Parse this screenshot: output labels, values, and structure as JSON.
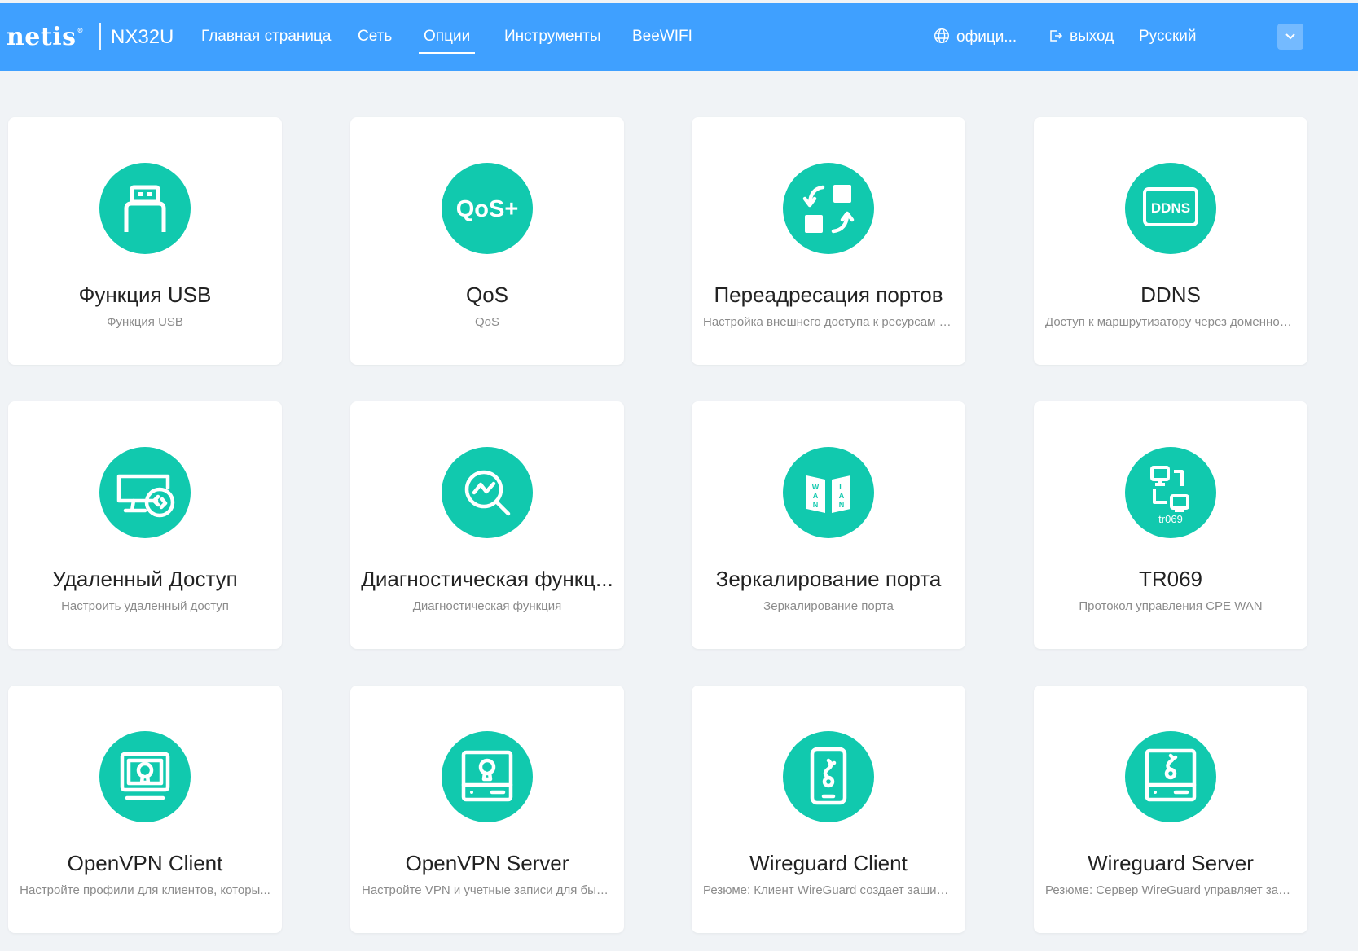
{
  "header": {
    "brand": "netis",
    "brand_mark": "®",
    "model": "NX32U",
    "nav": [
      {
        "label": "Главная страница"
      },
      {
        "label": "Сеть"
      },
      {
        "label": "Опции",
        "active": true
      },
      {
        "label": "Инструменты"
      },
      {
        "label": "BeeWIFI"
      }
    ],
    "official_label": "офици...",
    "official_icon": "globe-icon",
    "logout_label": "выход",
    "logout_icon": "logout-icon",
    "language": "Русский",
    "language_icon": "chevron-down-icon"
  },
  "colors": {
    "header_bg": "#3fa0ff",
    "accent": "#11c9ae",
    "page_bg": "#f0f3f6"
  },
  "cards": [
    {
      "title": "Функция USB",
      "desc": "Функция USB",
      "icon": "usb-icon",
      "icon_text": ""
    },
    {
      "title": "QoS",
      "desc": "QoS",
      "icon": "qos-icon",
      "icon_text": "QoS+"
    },
    {
      "title": "Переадресация портов",
      "desc": "Настройка внешнего доступа к ресурсам в...",
      "icon": "port-forwarding-icon",
      "icon_text": ""
    },
    {
      "title": "DDNS",
      "desc": "Доступ к маршрутизатору через доменное...",
      "icon": "ddns-icon",
      "icon_text": "DDNS"
    },
    {
      "title": "Удаленный Доступ",
      "desc": "Настроить удаленный доступ",
      "icon": "remote-access-icon",
      "icon_text": ""
    },
    {
      "title": "Диагностическая функц...",
      "desc": "Диагностическая функция",
      "icon": "diagnostic-icon",
      "icon_text": ""
    },
    {
      "title": "Зеркалирование порта",
      "desc": "Зеркалирование порта",
      "icon": "port-mirroring-icon",
      "icon_text": ""
    },
    {
      "title": "TR069",
      "desc": "Протокол управления CPE WAN",
      "icon": "tr069-icon",
      "icon_text": "tr069"
    },
    {
      "title": "OpenVPN Client",
      "desc": "Настройте профили для клиентов, которы...",
      "icon": "openvpn-client-icon",
      "icon_text": ""
    },
    {
      "title": "OpenVPN Server",
      "desc": "Настройте VPN и учетные записи для быст...",
      "icon": "openvpn-server-icon",
      "icon_text": ""
    },
    {
      "title": "Wireguard Client",
      "desc": "Резюме: Клиент WireGuard создает зашиф...",
      "icon": "wireguard-client-icon",
      "icon_text": ""
    },
    {
      "title": "Wireguard Server",
      "desc": "Резюме: Сервер WireGuard управляет заш...",
      "icon": "wireguard-server-icon",
      "icon_text": ""
    }
  ]
}
